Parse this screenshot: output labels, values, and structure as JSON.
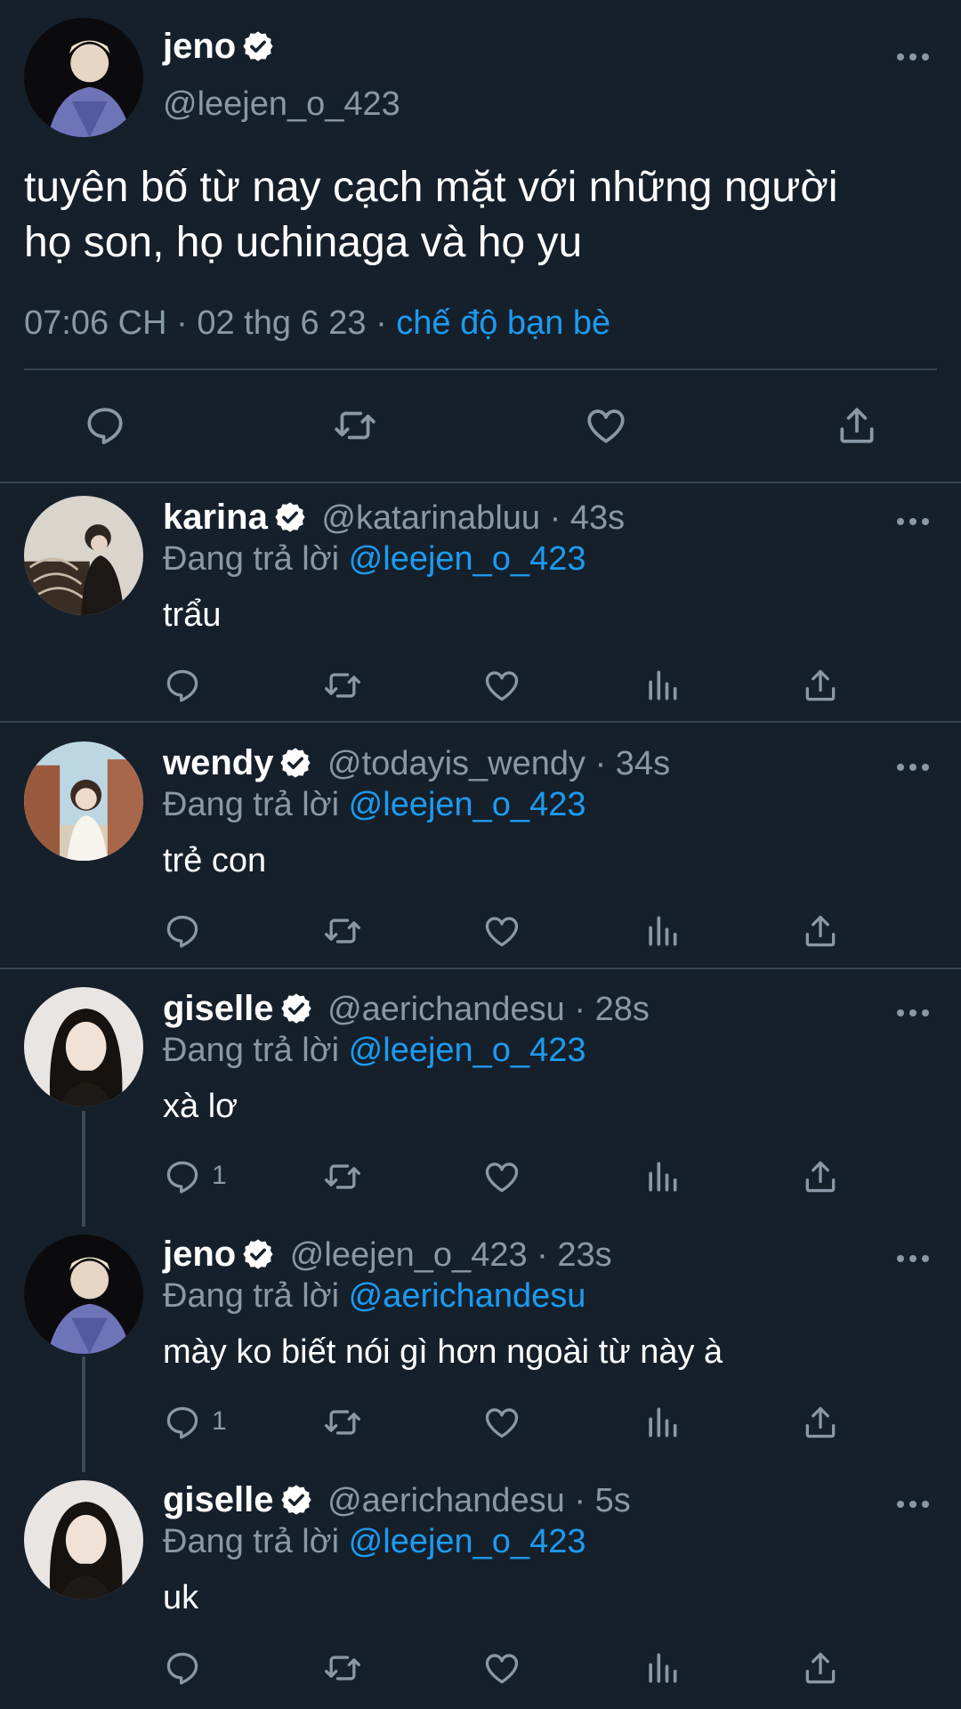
{
  "main_tweet": {
    "display_name": "jeno",
    "handle": "@leejen_o_423",
    "text_line1": "tuyên bố từ nay cạch mặt với những người",
    "text_line2": "họ son, họ uchinaga và họ yu",
    "time": "07:06 CH",
    "date": "02 thg 6 23",
    "separator": "·",
    "audience": "chế độ bạn bè"
  },
  "replies": [
    {
      "name": "karina",
      "handle": "@katarinabluu",
      "time": "43s",
      "reply_label": "Đang trả lời",
      "reply_to": "@leejen_o_423",
      "text": "trẩu",
      "reply_count": ""
    },
    {
      "name": "wendy",
      "handle": "@todayis_wendy",
      "time": "34s",
      "reply_label": "Đang trả lời",
      "reply_to": "@leejen_o_423",
      "text": "trẻ con",
      "reply_count": ""
    },
    {
      "name": "giselle",
      "handle": "@aerichandesu",
      "time": "28s",
      "reply_label": "Đang trả lời",
      "reply_to": "@leejen_o_423",
      "text": "xà lơ",
      "reply_count": "1"
    },
    {
      "name": "jeno",
      "handle": "@leejen_o_423",
      "time": "23s",
      "reply_label": "Đang trả lời",
      "reply_to": "@aerichandesu",
      "text": "mày ko biết nói gì hơn ngoài từ này à",
      "reply_count": "1"
    },
    {
      "name": "giselle",
      "handle": "@aerichandesu",
      "time": "5s",
      "reply_label": "Đang trả lời",
      "reply_to": "@leejen_o_423",
      "text": "uk",
      "reply_count": ""
    }
  ],
  "icons": [
    "reply-icon",
    "retweet-icon",
    "like-icon",
    "analytics-icon",
    "share-icon",
    "more-icon",
    "verified-icon"
  ],
  "colors": {
    "background": "#15202b",
    "link": "#1d9bf0",
    "muted": "#8b98a5",
    "divider": "#38444d",
    "verified": "#ffffff"
  }
}
